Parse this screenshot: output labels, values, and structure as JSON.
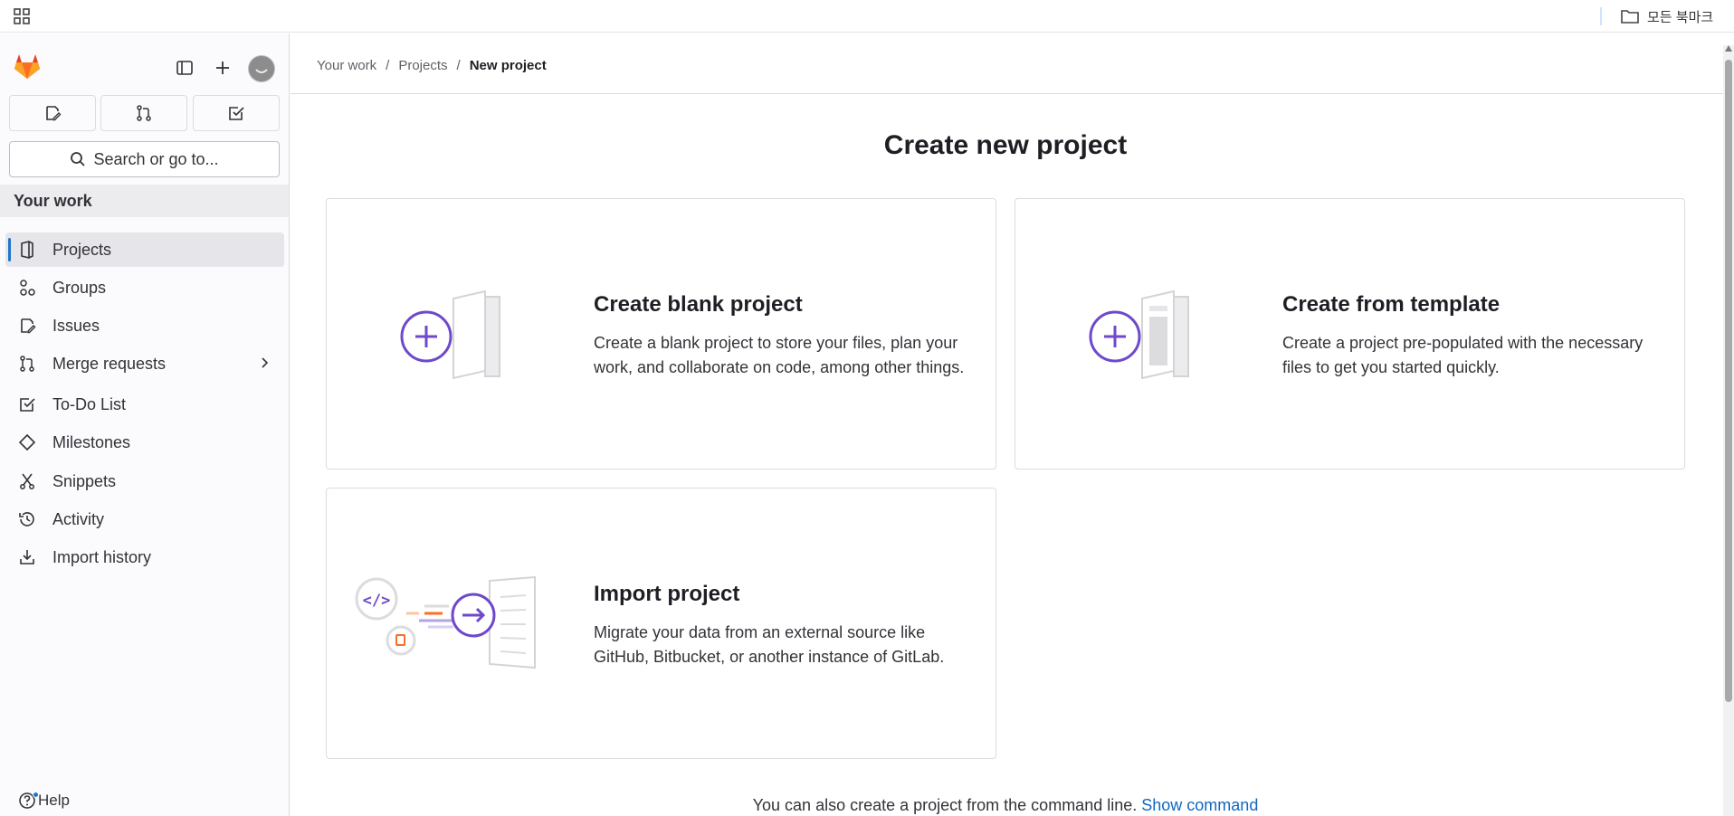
{
  "browser": {
    "bookmark_folder": "모든 북마크"
  },
  "sidebar": {
    "search_label": "Search or go to...",
    "section_title": "Your work",
    "items": [
      {
        "label": "Projects",
        "icon": "project-icon",
        "active": true
      },
      {
        "label": "Groups",
        "icon": "group-icon"
      },
      {
        "label": "Issues",
        "icon": "issues-icon"
      },
      {
        "label": "Merge requests",
        "icon": "merge-request-icon",
        "has_chevron": true
      },
      {
        "label": "To-Do List",
        "icon": "todo-icon"
      },
      {
        "label": "Milestones",
        "icon": "milestone-icon"
      },
      {
        "label": "Snippets",
        "icon": "snippet-icon"
      },
      {
        "label": "Activity",
        "icon": "history-icon"
      },
      {
        "label": "Import history",
        "icon": "import-icon"
      }
    ],
    "help_label": "Help"
  },
  "breadcrumb": [
    "Your work",
    "Projects",
    "New project"
  ],
  "main": {
    "title": "Create new project",
    "cards": [
      {
        "title": "Create blank project",
        "description": "Create a blank project to store your files, plan your work, and collaborate on code, among other things."
      },
      {
        "title": "Create from template",
        "description": "Create a project pre-populated with the necessary files to get you started quickly."
      },
      {
        "title": "Import project",
        "description": "Migrate your data from an external source like GitHub, Bitbucket, or another instance of GitLab."
      }
    ],
    "cmdline_text": "You can also create a project from the command line.",
    "cmdline_link": "Show command"
  },
  "colors": {
    "accent_purple": "#6e49cb",
    "active_indicator": "#1f75cb",
    "link": "#1068bf"
  }
}
